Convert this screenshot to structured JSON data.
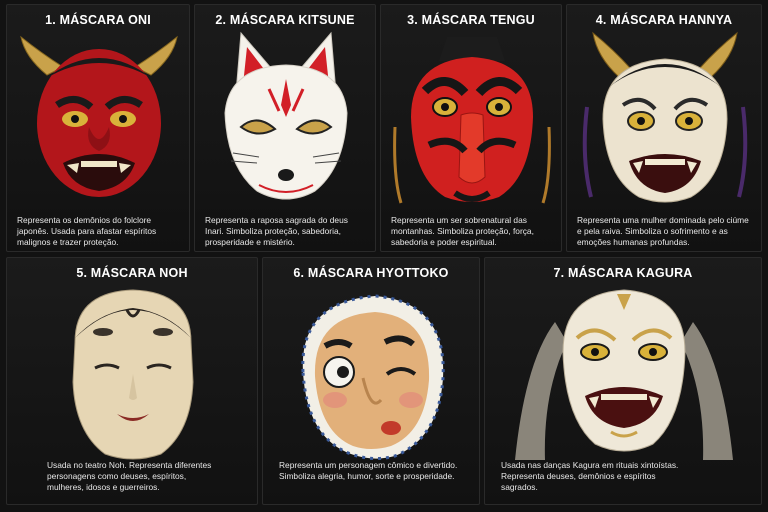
{
  "cards": [
    {
      "title": "1. MÁSCARA ONI",
      "description": "Representa os demônios do folclore japonês. Usada para afastar espíritos malignos e trazer proteção."
    },
    {
      "title": "2. MÁSCARA KITSUNE",
      "description": "Representa a raposa sagrada do deus Inari. Simboliza proteção, sabedoria, prosperidade e mistério."
    },
    {
      "title": "3. MÁSCARA TENGU",
      "description": "Representa um ser sobrenatural das montanhas. Simboliza proteção, força, sabedoria e poder espiritual."
    },
    {
      "title": "4. MÁSCARA HANNYA",
      "description": "Representa uma mulher dominada pelo ciúme e pela raiva. Simboliza o sofrimento e as emoções humanas profundas."
    },
    {
      "title": "5. MÁSCARA NOH",
      "description": "Usada no teatro Noh. Representa diferentes personagens como deuses, espíritos, mulheres, idosos e guerreiros."
    },
    {
      "title": "6. MÁSCARA HYOTTOKO",
      "description": "Representa um personagem cômico e divertido. Simboliza alegria, humor, sorte e prosperidade."
    },
    {
      "title": "7. MÁSCARA KAGURA",
      "description": "Usada nas danças Kagura em rituais xintoístas. Representa deuses, demônios e espíritos sagrados."
    }
  ]
}
